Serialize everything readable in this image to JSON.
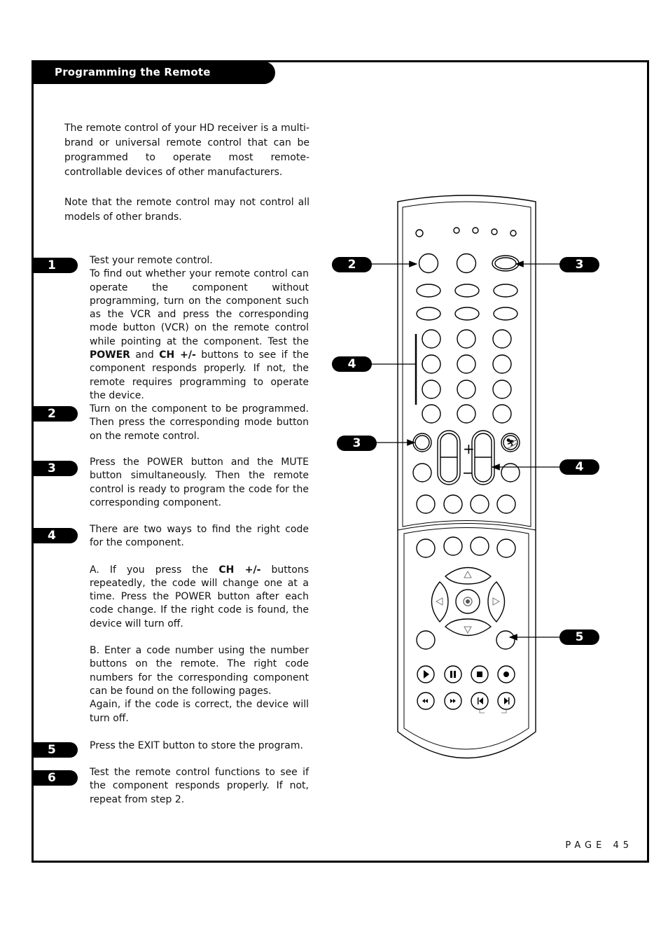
{
  "header": {
    "title": "Programming the Remote"
  },
  "intro": [
    "The remote control of your HD receiver is a multi-brand or universal remote control that can be programmed to operate most remote-controllable devices of other manufacturers.",
    "Note that the remote control may not control all models of other brands."
  ],
  "steps": [
    {
      "number": "1",
      "paragraphs": [
        "Test your remote control.",
        "To find out whether your remote control can operate the component without programming, turn on the component such as the VCR and press the corresponding mode button (VCR) on the remote control while pointing at the component. Test the POWER and CH +/- buttons to see if the component responds properly. If not, the remote requires programming to operate the device."
      ]
    },
    {
      "number": "2",
      "paragraphs": [
        "Turn on the component to be programmed. Then press the corresponding mode button on the remote control."
      ]
    },
    {
      "number": "3",
      "paragraphs": [
        "Press the POWER button and the MUTE button simultaneously. Then the remote control is ready to program the code for the corresponding component."
      ]
    },
    {
      "number": "4",
      "paragraphs": [
        "There are two ways to find the right code for the component.",
        "A. If  you press the CH +/- buttons repeatedly, the code will change one at a time. Press the POWER button after each code change. If the right code is found, the device will turn off.",
        "B. Enter a code number using the number buttons on the remote. The right code numbers for the corresponding component can be found on the following pages.",
        "Again, if the code is correct, the device will turn off."
      ]
    },
    {
      "number": "5",
      "paragraphs": [
        "Press the EXIT button to store the program."
      ]
    },
    {
      "number": "6",
      "paragraphs": [
        "Test the remote control functions to see if the component responds properly. If not, repeat from step 2."
      ]
    }
  ],
  "diagram": {
    "callouts": [
      {
        "label": "2",
        "target": "mode-button"
      },
      {
        "label": "3",
        "target": "power-button"
      },
      {
        "label": "4",
        "target": "number-buttons"
      },
      {
        "label": "3",
        "target": "mute-button"
      },
      {
        "label": "4",
        "target": "ch-rocker"
      },
      {
        "label": "5",
        "target": "exit-button"
      }
    ],
    "rocker_plus": "+",
    "rocker_minus": "−"
  },
  "footer": {
    "page_label": "PAGE 45"
  }
}
